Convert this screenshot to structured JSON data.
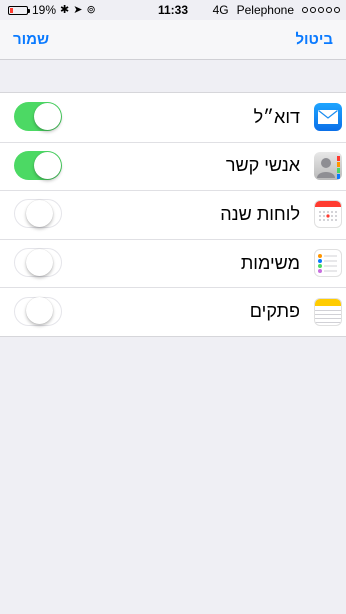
{
  "status_bar": {
    "battery": "19%",
    "battery_level": 0.19,
    "time": "11:33",
    "network": "4G",
    "carrier": "Pelephone"
  },
  "nav": {
    "left_label": "שמור",
    "right_label": "ביטול"
  },
  "accounts": [
    {
      "label": "דוא״ל",
      "enabled": true,
      "icon": "mail-icon"
    },
    {
      "label": "אנשי קשר",
      "enabled": true,
      "icon": "contacts-icon"
    },
    {
      "label": "לוחות שנה",
      "enabled": false,
      "icon": "calendar-icon"
    },
    {
      "label": "משימות",
      "enabled": false,
      "icon": "reminders-icon"
    },
    {
      "label": "פתקים",
      "enabled": false,
      "icon": "notes-icon"
    }
  ],
  "colors": {
    "accent": "#0a7aff",
    "toggle_on": "#4cd964",
    "background": "#efeff4"
  }
}
